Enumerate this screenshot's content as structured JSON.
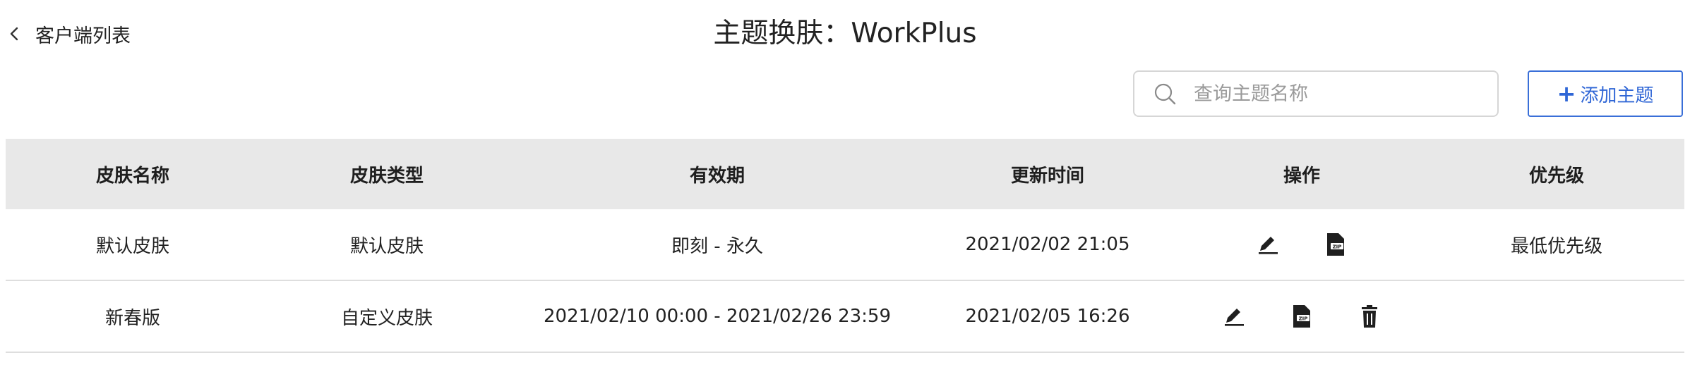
{
  "header": {
    "back_label": "客户端列表",
    "title": "主题换肤：WorkPlus"
  },
  "toolbar": {
    "search_placeholder": "查询主题名称",
    "add_label": "添加主题"
  },
  "table": {
    "columns": [
      "皮肤名称",
      "皮肤类型",
      "有效期",
      "更新时间",
      "操作",
      "优先级"
    ],
    "rows": [
      {
        "name": "默认皮肤",
        "type": "默认皮肤",
        "validity": "即刻 - 永久",
        "updated": "2021/02/02 21:05",
        "actions": [
          "edit-icon",
          "zip-download-icon"
        ],
        "priority": "最低优先级"
      },
      {
        "name": "新春版",
        "type": "自定义皮肤",
        "validity": "2021/02/10 00:00 - 2021/02/26 23:59",
        "updated": "2021/02/05 16:26",
        "actions": [
          "edit-icon",
          "zip-download-icon",
          "delete-icon"
        ],
        "priority": ""
      }
    ]
  }
}
